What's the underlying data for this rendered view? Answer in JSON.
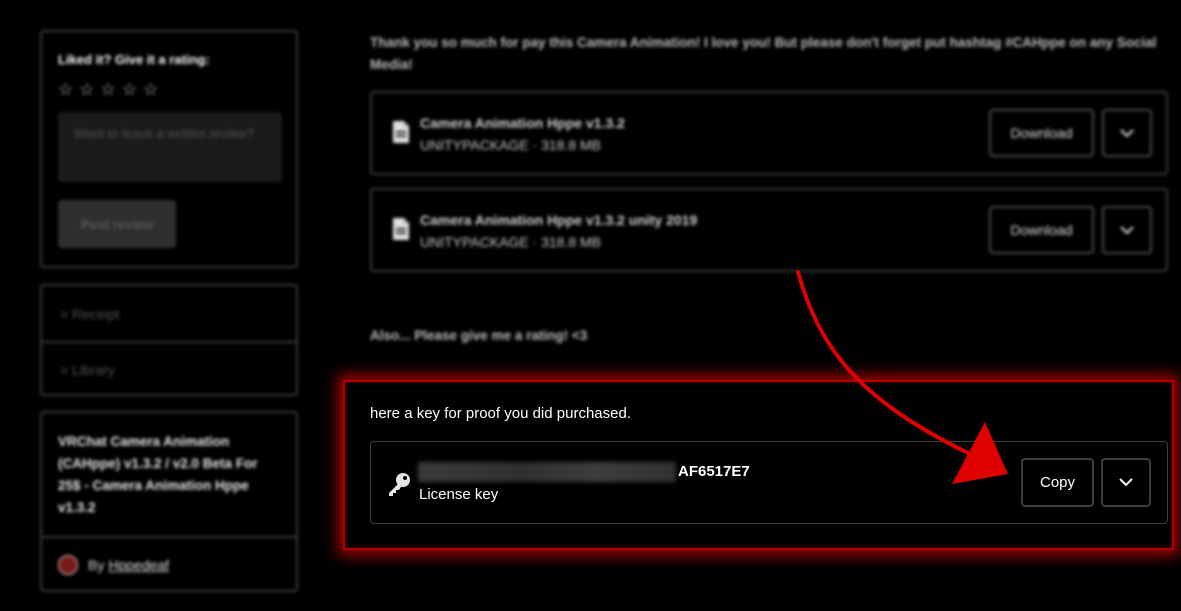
{
  "sidebar": {
    "rating": {
      "title": "Liked it? Give it a rating:",
      "stars": [
        "☆",
        "☆",
        "☆",
        "☆",
        "☆"
      ],
      "review_placeholder": "Want to leave a written review?",
      "post_label": "Post review"
    },
    "links": [
      {
        "label": "> Receipt"
      },
      {
        "label": "> Library"
      }
    ],
    "product": {
      "title": "VRChat Camera Animation (CAHppe) v1.3.2 / v2.0 Beta For 25$ - Camera Animation Hppe v1.3.2",
      "by_label": "By",
      "author": "Hppedeaf"
    }
  },
  "main": {
    "thanks_message": "Thank you so much for pay this Camera Animation! I love you! But please don't forget put hashtag #CAHppe on any Social Media!",
    "files": [
      {
        "name": "Camera Animation Hppe v1.3.2",
        "meta": "UNITYPACKAGE · 318.8 MB",
        "download_label": "Download"
      },
      {
        "name": "Camera Animation Hppe v1.3.2 unity 2019",
        "meta": "UNITYPACKAGE · 318.8 MB",
        "download_label": "Download"
      }
    ],
    "rating_request": "Also... Please give me a rating! <3",
    "license": {
      "note": "here a key for proof you did purchased.",
      "key_visible_suffix": "AF6517E7",
      "label": "License key",
      "copy_label": "Copy"
    }
  },
  "colors": {
    "background": "#000000",
    "highlight": "#cc0000",
    "annotation_arrow": "#e00000"
  },
  "icons": {
    "file": "file-icon",
    "key": "key-icon",
    "chevron": "chevron-down-icon",
    "star": "star-outline-icon"
  }
}
